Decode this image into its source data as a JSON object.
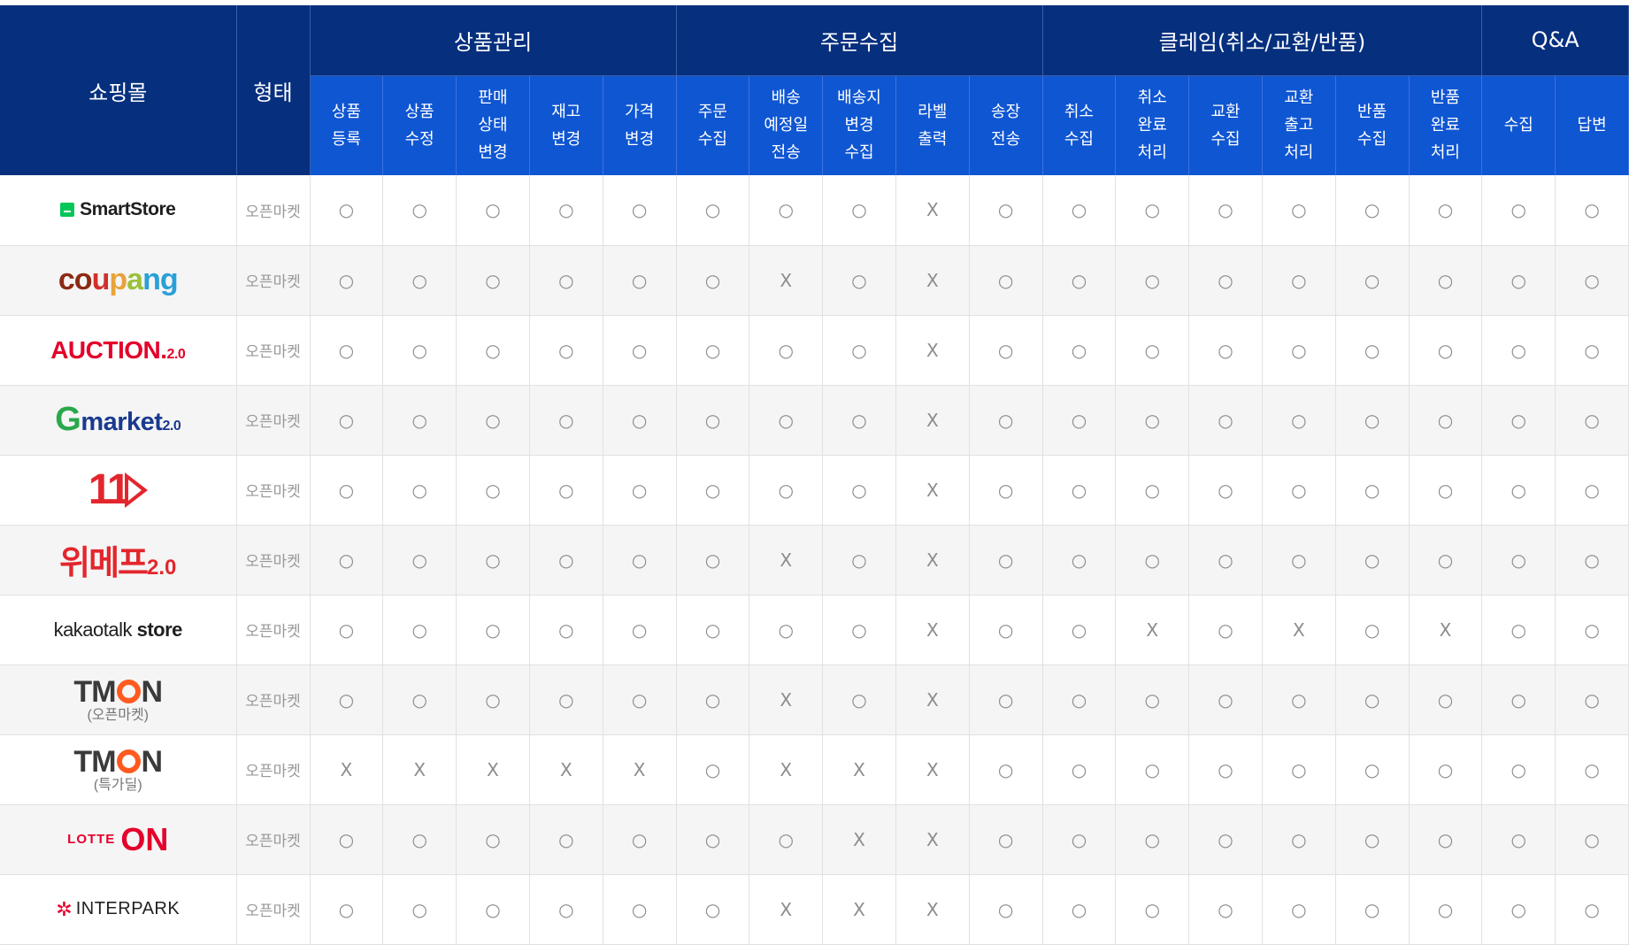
{
  "header": {
    "mall": "쇼핑몰",
    "type": "형태",
    "groups": [
      {
        "label": "상품관리",
        "items": [
          "상품\n등록",
          "상품\n수정",
          "판매\n상태\n변경",
          "재고\n변경",
          "가격\n변경"
        ]
      },
      {
        "label": "주문수집",
        "items": [
          "주문\n수집",
          "배송\n예정일\n전송",
          "배송지\n변경\n수집",
          "라벨\n출력",
          "송장\n전송"
        ]
      },
      {
        "label": "클레임(취소/교환/반품)",
        "items": [
          "취소\n수집",
          "취소\n완료\n처리",
          "교환\n수집",
          "교환\n출고\n처리",
          "반품\n수집",
          "반품\n완료\n처리"
        ]
      },
      {
        "label": "Q&A",
        "items": [
          "수집",
          "답변"
        ]
      }
    ]
  },
  "symbols": {
    "yes": "○",
    "no": "X"
  },
  "colors": {
    "header_dark": "#062f7e",
    "header_light": "#0f56d2",
    "row_alt": "#f5f5f5"
  },
  "rows": [
    {
      "logo": "smartstore",
      "name": "SmartStore",
      "type": "오픈마켓",
      "values": [
        "○",
        "○",
        "○",
        "○",
        "○",
        "○",
        "○",
        "○",
        "X",
        "○",
        "○",
        "○",
        "○",
        "○",
        "○",
        "○",
        "○",
        "○"
      ]
    },
    {
      "logo": "coupang",
      "name": "coupang",
      "type": "오픈마켓",
      "values": [
        "○",
        "○",
        "○",
        "○",
        "○",
        "○",
        "X",
        "○",
        "X",
        "○",
        "○",
        "○",
        "○",
        "○",
        "○",
        "○",
        "○",
        "○"
      ]
    },
    {
      "logo": "auction",
      "name": "AUCTION.",
      "suffix": "2.0",
      "type": "오픈마켓",
      "values": [
        "○",
        "○",
        "○",
        "○",
        "○",
        "○",
        "○",
        "○",
        "X",
        "○",
        "○",
        "○",
        "○",
        "○",
        "○",
        "○",
        "○",
        "○"
      ]
    },
    {
      "logo": "gmarket",
      "name": "market",
      "initial": "G",
      "suffix": "2.0",
      "type": "오픈마켓",
      "values": [
        "○",
        "○",
        "○",
        "○",
        "○",
        "○",
        "○",
        "○",
        "X",
        "○",
        "○",
        "○",
        "○",
        "○",
        "○",
        "○",
        "○",
        "○"
      ]
    },
    {
      "logo": "11st",
      "name": "11",
      "type": "오픈마켓",
      "values": [
        "○",
        "○",
        "○",
        "○",
        "○",
        "○",
        "○",
        "○",
        "X",
        "○",
        "○",
        "○",
        "○",
        "○",
        "○",
        "○",
        "○",
        "○"
      ]
    },
    {
      "logo": "wemakeprice",
      "name": "위메프",
      "suffix": "2.0",
      "type": "오픈마켓",
      "values": [
        "○",
        "○",
        "○",
        "○",
        "○",
        "○",
        "X",
        "○",
        "X",
        "○",
        "○",
        "○",
        "○",
        "○",
        "○",
        "○",
        "○",
        "○"
      ]
    },
    {
      "logo": "kakao",
      "name": "kakaotalk",
      "name2": "store",
      "type": "오픈마켓",
      "values": [
        "○",
        "○",
        "○",
        "○",
        "○",
        "○",
        "○",
        "○",
        "X",
        "○",
        "○",
        "X",
        "○",
        "X",
        "○",
        "X",
        "○",
        "○"
      ]
    },
    {
      "logo": "tmon",
      "name_a": "TM",
      "name_b": "N",
      "sub": "(오픈마켓)",
      "type": "오픈마켓",
      "values": [
        "○",
        "○",
        "○",
        "○",
        "○",
        "○",
        "X",
        "○",
        "X",
        "○",
        "○",
        "○",
        "○",
        "○",
        "○",
        "○",
        "○",
        "○"
      ]
    },
    {
      "logo": "tmon",
      "name_a": "TM",
      "name_b": "N",
      "sub": "(특가딜)",
      "type": "오픈마켓",
      "values": [
        "X",
        "X",
        "X",
        "X",
        "X",
        "○",
        "X",
        "X",
        "X",
        "○",
        "○",
        "○",
        "○",
        "○",
        "○",
        "○",
        "○",
        "○"
      ]
    },
    {
      "logo": "lotteon",
      "name": "LOTTE",
      "name2": "ON",
      "type": "오픈마켓",
      "values": [
        "○",
        "○",
        "○",
        "○",
        "○",
        "○",
        "○",
        "X",
        "X",
        "○",
        "○",
        "○",
        "○",
        "○",
        "○",
        "○",
        "○",
        "○"
      ]
    },
    {
      "logo": "interpark",
      "name": "INTERPARK",
      "type": "오픈마켓",
      "values": [
        "○",
        "○",
        "○",
        "○",
        "○",
        "○",
        "X",
        "X",
        "X",
        "○",
        "○",
        "○",
        "○",
        "○",
        "○",
        "○",
        "○",
        "○"
      ]
    }
  ]
}
